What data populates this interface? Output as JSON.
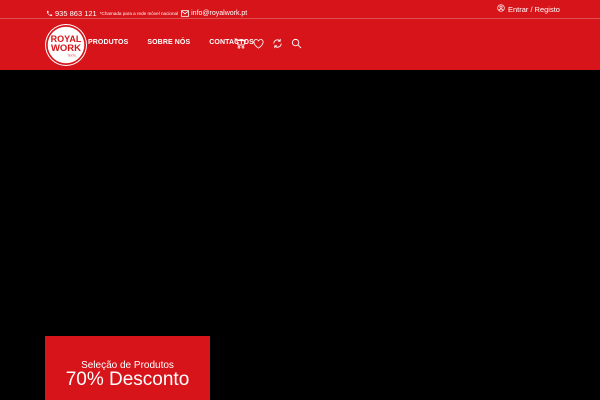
{
  "topbar": {
    "phone": "935 863 121",
    "phone_note": "*Chamada para a rede móvel nacional",
    "email": "info@royalwork.pt",
    "login_label": "Entrar",
    "separator": "/",
    "register_label": "Registo"
  },
  "logo": {
    "line1": "ROYAL",
    "line2": "WORK",
    "tagline": "TEXTIL"
  },
  "nav": {
    "items": [
      "PRODUTOS",
      "SOBRE NÓS",
      "CONTACTOS"
    ]
  },
  "header_icons": [
    "cart-icon",
    "heart-icon",
    "refresh-icon",
    "search-icon"
  ],
  "promo": {
    "subtitle": "Seleção de Produtos",
    "title": "70% Desconto"
  },
  "colors": {
    "brand_red": "#d7141a",
    "hero_bg": "#000000",
    "text": "#ffffff"
  }
}
